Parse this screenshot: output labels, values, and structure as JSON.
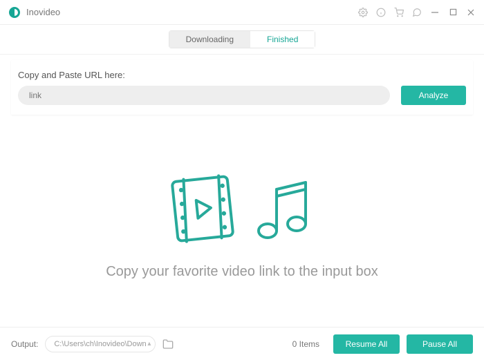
{
  "app": {
    "name": "Inovideo"
  },
  "tabs": {
    "downloading": "Downloading",
    "finished": "Finished"
  },
  "url_section": {
    "label": "Copy and Paste URL here:",
    "placeholder": "link",
    "analyze_label": "Analyze"
  },
  "main": {
    "empty_message": "Copy your favorite video link to the input box"
  },
  "footer": {
    "output_label": "Output:",
    "output_path": "C:\\Users\\ch\\Inovideo\\Downl",
    "items_count": "0 Items",
    "resume_label": "Resume All",
    "pause_label": "Pause All"
  }
}
